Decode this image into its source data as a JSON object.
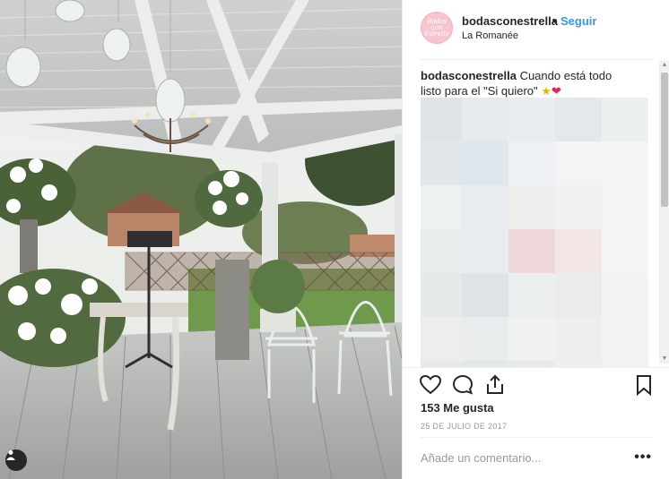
{
  "post": {
    "photo_alt": "",
    "username": "bodasconestrella",
    "dot": "•",
    "follow_label": "Seguir",
    "location": "La Romanée",
    "avatar_text": "Bodas con Estrella",
    "caption_user": "bodasconestrella",
    "caption_text": "Cuando está todo listo para el \"Si quiero\"",
    "caption_emojis": [
      "star",
      "heart"
    ],
    "likes": "153 Me gusta",
    "date": "25 DE JULIO DE 2017",
    "comment_placeholder": "Añade un comentario...",
    "more_label": "•••"
  },
  "icons": {
    "like": "heart-outline-icon",
    "comment": "speech-bubble-icon",
    "share": "share-arrow-icon",
    "save": "bookmark-icon",
    "user_tag": "person-icon"
  },
  "colors": {
    "follow": "#3897f0",
    "text": "#262626",
    "muted": "#999999",
    "border": "#efefef",
    "avatar": "#f6c6cf"
  }
}
